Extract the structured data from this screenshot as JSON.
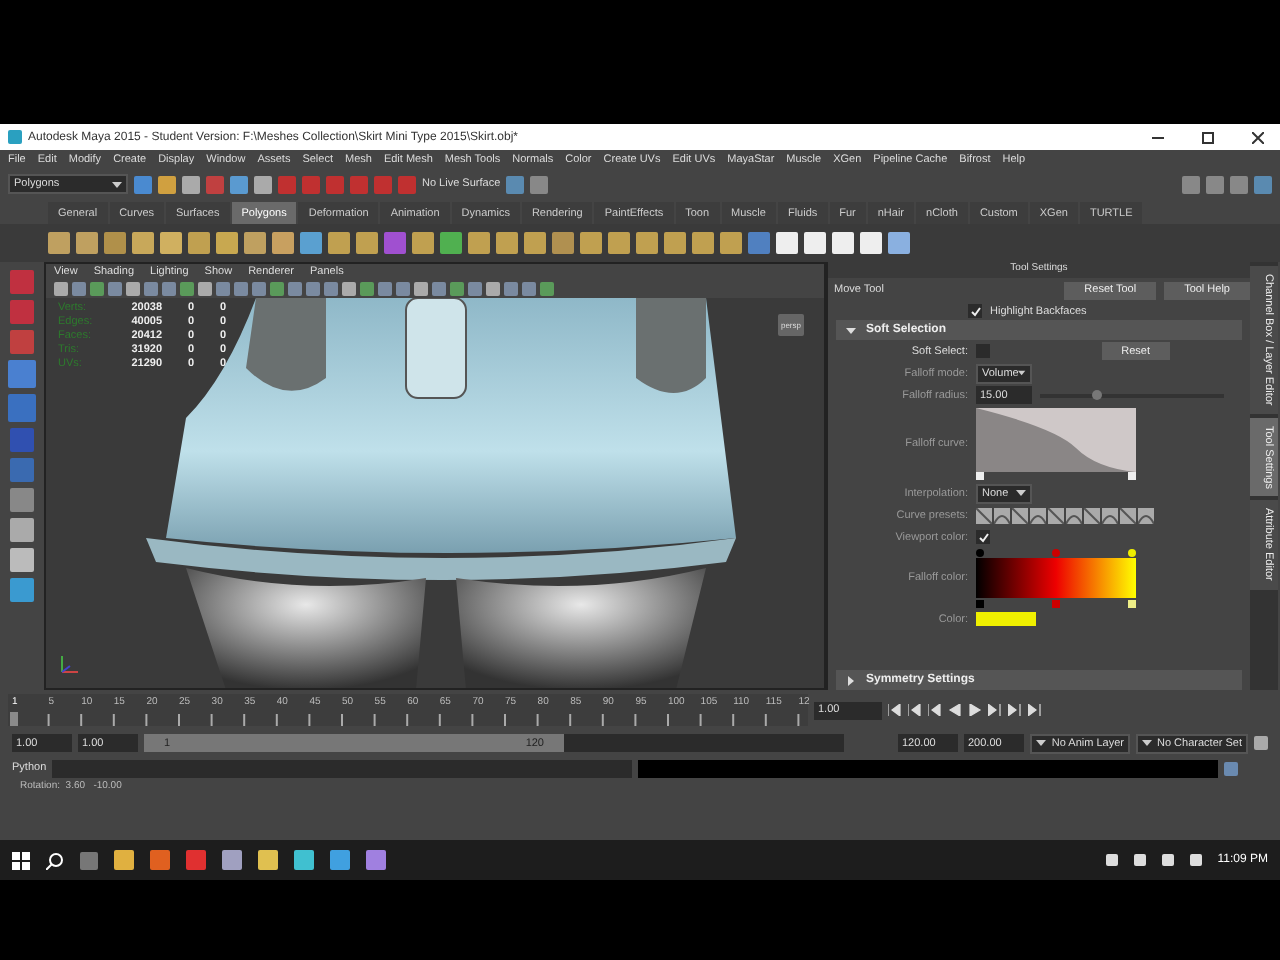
{
  "window": {
    "title": "Autodesk Maya 2015 - Student Version: F:\\Meshes Collection\\Skirt Mini Type 2015\\Skirt.obj*"
  },
  "menu": [
    "File",
    "Edit",
    "Modify",
    "Create",
    "Display",
    "Window",
    "Assets",
    "Select",
    "Mesh",
    "Edit Mesh",
    "Mesh Tools",
    "Normals",
    "Color",
    "Create UVs",
    "Edit UVs",
    "MayaStar",
    "Muscle",
    "XGen",
    "Pipeline Cache",
    "Bifrost",
    "Help"
  ],
  "status_line": {
    "mode": "Polygons",
    "live_surface": "No Live Surface"
  },
  "shelf_tabs": [
    {
      "label": "General",
      "selected": false
    },
    {
      "label": "Curves",
      "selected": false
    },
    {
      "label": "Surfaces",
      "selected": false
    },
    {
      "label": "Polygons",
      "selected": true
    },
    {
      "label": "Deformation",
      "selected": false
    },
    {
      "label": "Animation",
      "selected": false
    },
    {
      "label": "Dynamics",
      "selected": false
    },
    {
      "label": "Rendering",
      "selected": false
    },
    {
      "label": "PaintEffects",
      "selected": false
    },
    {
      "label": "Toon",
      "selected": false
    },
    {
      "label": "Muscle",
      "selected": false
    },
    {
      "label": "Fluids",
      "selected": false
    },
    {
      "label": "Fur",
      "selected": false
    },
    {
      "label": "nHair",
      "selected": false
    },
    {
      "label": "nCloth",
      "selected": false
    },
    {
      "label": "Custom",
      "selected": false
    },
    {
      "label": "XGen",
      "selected": false
    },
    {
      "label": "TURTLE",
      "selected": false
    }
  ],
  "viewport": {
    "menu": [
      "View",
      "Shading",
      "Lighting",
      "Show",
      "Renderer",
      "Panels"
    ],
    "hud": [
      {
        "label": "Verts:",
        "values": [
          "20038",
          "0",
          "0"
        ]
      },
      {
        "label": "Edges:",
        "values": [
          "40005",
          "0",
          "0"
        ]
      },
      {
        "label": "Faces:",
        "values": [
          "20412",
          "0",
          "0"
        ]
      },
      {
        "label": "Tris:",
        "values": [
          "31920",
          "0",
          "0"
        ]
      },
      {
        "label": "UVs:",
        "values": [
          "21290",
          "0",
          "0"
        ]
      }
    ],
    "corner_label": "persp"
  },
  "tool_settings": {
    "title": "Tool Settings",
    "tool": "Move Tool",
    "buttons": [
      "Reset Tool",
      "Tool Help"
    ],
    "highlight_backfaces": {
      "label": "Highlight Backfaces",
      "checked": true
    },
    "sections": [
      {
        "title": "Soft Selection",
        "expanded": true
      },
      {
        "title": "Symmetry Settings",
        "expanded": false
      }
    ],
    "soft_select": {
      "label": "Soft Select:",
      "checked": false,
      "reset": "Reset"
    },
    "falloff_mode": {
      "label": "Falloff mode:",
      "value": "Volume"
    },
    "falloff_radius": {
      "label": "Falloff radius:",
      "value": "15.00",
      "level": 0.3
    },
    "falloff_curve": {
      "label": "Falloff curve:"
    },
    "interpolation": {
      "label": "Interpolation:",
      "value": "None"
    },
    "curve_presets": {
      "label": "Curve presets:"
    },
    "viewport_color": {
      "label": "Viewport color:",
      "checked": true
    },
    "falloff_color": {
      "label": "Falloff color:"
    },
    "color": {
      "label": "Color:"
    }
  },
  "side_tabs": [
    {
      "label": "Channel Box / Layer Editor",
      "selected": false
    },
    {
      "label": "Tool Settings",
      "selected": true
    },
    {
      "label": "Attribute Editor",
      "selected": false
    }
  ],
  "timeline": {
    "current_frame": "1",
    "level": 0.0,
    "ticks": [
      "5",
      "10",
      "15",
      "20",
      "25",
      "30",
      "35",
      "40",
      "45",
      "50",
      "55",
      "60",
      "65",
      "70",
      "75",
      "80",
      "85",
      "90",
      "95",
      "100",
      "105",
      "110",
      "115",
      "12"
    ],
    "frame_field": "1.00"
  },
  "range": {
    "start": "1.00",
    "playback_start": "1.00",
    "slider_start": "1",
    "slider_end": "120",
    "level": 0.6,
    "playback_end": "120.00",
    "end": "200.00",
    "anim_layer": "No Anim Layer",
    "character_set": "No Character Set"
  },
  "command_line": {
    "language": "Python"
  },
  "help_line": "Rotation:  3.60   -10.00",
  "taskbar": {
    "time": "11:09 PM"
  }
}
